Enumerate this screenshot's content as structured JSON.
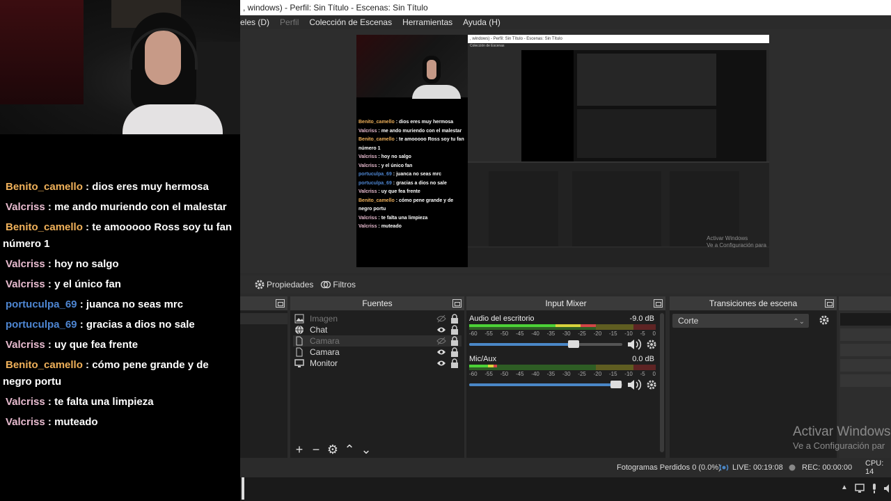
{
  "window": {
    "title": ", windows) - Perfil: Sin Título - Escenas: Sin Título"
  },
  "menu": [
    "eles (D)",
    "Perfil",
    "Colección de Escenas",
    "Herramientas",
    "Ayuda (H)"
  ],
  "chat": [
    {
      "user": "Benito_camello",
      "text": "dios eres muy hermosa",
      "color": "#f0b15a"
    },
    {
      "user": "Valcriss",
      "text": "me ando muriendo con el malestar",
      "color": "#e9bcd0"
    },
    {
      "user": "Benito_camello",
      "text": "te amooooo Ross soy tu fan número 1",
      "color": "#f0b15a"
    },
    {
      "user": "Valcriss",
      "text": "hoy no salgo",
      "color": "#e9bcd0"
    },
    {
      "user": "Valcriss",
      "text": "y el único fan",
      "color": "#e9bcd0"
    },
    {
      "user": "portuculpa_69",
      "text": "juanca no seas mrc",
      "color": "#4e86d2"
    },
    {
      "user": "portuculpa_69",
      "text": "gracias a dios no sale",
      "color": "#4e86d2"
    },
    {
      "user": "Valcriss",
      "text": "uy que fea frente",
      "color": "#e9bcd0"
    },
    {
      "user": "Benito_camello",
      "text": "cómo pene grande y de negro portu",
      "color": "#f0b15a"
    },
    {
      "user": "Valcriss",
      "text": "te falta una limpieza",
      "color": "#e9bcd0"
    },
    {
      "user": "Valcriss",
      "text": "muteado",
      "color": "#e9bcd0"
    }
  ],
  "toolbar": {
    "properties": "Propiedades",
    "filters": "Filtros"
  },
  "docks": {
    "sources_title": "Fuentes",
    "mixer_title": "Input Mixer",
    "transitions_title": "Transiciones de escena"
  },
  "sources": [
    {
      "name": "Imagen",
      "visible": false,
      "icon": "image-icon"
    },
    {
      "name": "Chat",
      "visible": true,
      "icon": "browser-icon"
    },
    {
      "name": "Camara",
      "visible": false,
      "icon": "file-icon"
    },
    {
      "name": "Camara",
      "visible": true,
      "icon": "file-icon"
    },
    {
      "name": "Monitor",
      "visible": true,
      "icon": "monitor-icon"
    }
  ],
  "mixer": [
    {
      "name": "Audio del escritorio",
      "db": "-9.0 dB",
      "meter_level": 0.68,
      "fader": 0.68
    },
    {
      "name": "Mic/Aux",
      "db": "0.0 dB",
      "meter_level": 0.15,
      "fader": 0.96
    }
  ],
  "meter_ticks": [
    "-60",
    "-55",
    "-50",
    "-45",
    "-40",
    "-35",
    "-30",
    "-25",
    "-20",
    "-15",
    "-10",
    "-5",
    "0"
  ],
  "transition": {
    "selected": "Corte"
  },
  "status": {
    "dropped": "Fotogramas Perdidos 0 (0.0%)",
    "live": "LIVE: 00:19:08",
    "rec": "REC: 00:00:00",
    "cpu": "CPU: 14"
  },
  "watermark": {
    "line1": "Activar Windows",
    "line2": "Ve a Configuración par"
  },
  "preview_watermark": {
    "line1": "Activar Windows",
    "line2": "Ve a Configuración para"
  }
}
